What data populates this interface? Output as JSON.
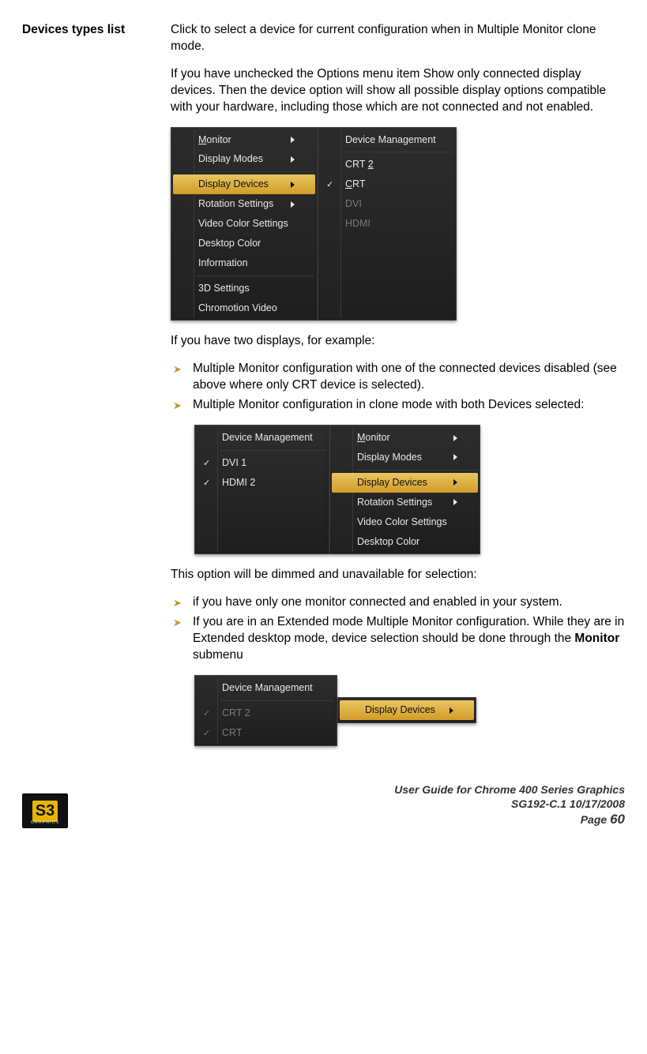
{
  "section": {
    "label": "Devices types list",
    "p1": "Click to select a device for current configuration when in Multiple Monitor clone mode.",
    "p2": "If you have unchecked the Options menu item Show only connected display devices. Then the device option will show all possible display options compatible with your hardware, including those which are not connected and not enabled.",
    "intro2": "If you have two displays, for  example:",
    "bullets1": [
      "Multiple Monitor configuration with one of the connected devices disabled (see above where only CRT device is selected).",
      "Multiple Monitor configuration in clone mode with both Devices selected:"
    ],
    "intro3": "This option will be dimmed and unavailable for selection:",
    "bullets2_a": "if you have only one monitor connected and enabled in your system.",
    "bullets2_b_pre": "If you are in an Extended mode Multiple Monitor configuration. While they are in Extended desktop mode, device selection should be done through the ",
    "bullets2_b_bold": "Monitor",
    "bullets2_b_post": " submenu"
  },
  "menu1_left": [
    {
      "label": "Monitor",
      "arrow": true,
      "ulFirst": true
    },
    {
      "label": "Display Modes",
      "arrow": true,
      "ulFirst": false
    },
    {
      "sep": true
    },
    {
      "label": "Display Devices",
      "arrow": true,
      "hl": true
    },
    {
      "label": "Rotation Settings",
      "arrow": true
    },
    {
      "label": "Video Color Settings"
    },
    {
      "label": "Desktop Color"
    },
    {
      "label": "Information"
    },
    {
      "sep": true
    },
    {
      "label": "3D Settings"
    },
    {
      "label": "Chromotion Video"
    }
  ],
  "menu1_right": {
    "header": "Device Management",
    "items": [
      {
        "label": "CRT 2",
        "check": false,
        "ul": "2"
      },
      {
        "label": "CRT",
        "check": true,
        "ul": "C"
      },
      {
        "label": "DVI",
        "check": false,
        "disabled": true
      },
      {
        "label": "HDMI",
        "check": false,
        "disabled": true
      }
    ]
  },
  "menu2_left_header": "Device Management",
  "menu2_left_items": [
    {
      "label": "DVI 1",
      "check": true
    },
    {
      "label": "HDMI 2",
      "check": true
    }
  ],
  "menu2_right": [
    {
      "label": "Monitor",
      "arrow": true,
      "ulFirst": true
    },
    {
      "label": "Display Modes",
      "arrow": true
    },
    {
      "sep": true
    },
    {
      "label": "Display Devices",
      "arrow": true,
      "hl": true
    },
    {
      "label": "Rotation Settings",
      "arrow": true
    },
    {
      "label": "Video Color Settings"
    },
    {
      "label": "Desktop Color"
    }
  ],
  "menu3_left_header": "Device Management",
  "menu3_left_items": [
    {
      "label": "CRT 2",
      "check": true,
      "disabled": true
    },
    {
      "label": "CRT",
      "check": true,
      "disabled": true
    }
  ],
  "menu3_right_label": "Display Devices",
  "footer": {
    "title": "User Guide for Chrome 400 Series Graphics",
    "meta": "SG192-C.1   10/17/2008",
    "page_label": "Page ",
    "page_num": "60",
    "logo": "S3",
    "logo_sub": "GRAPHICS"
  }
}
